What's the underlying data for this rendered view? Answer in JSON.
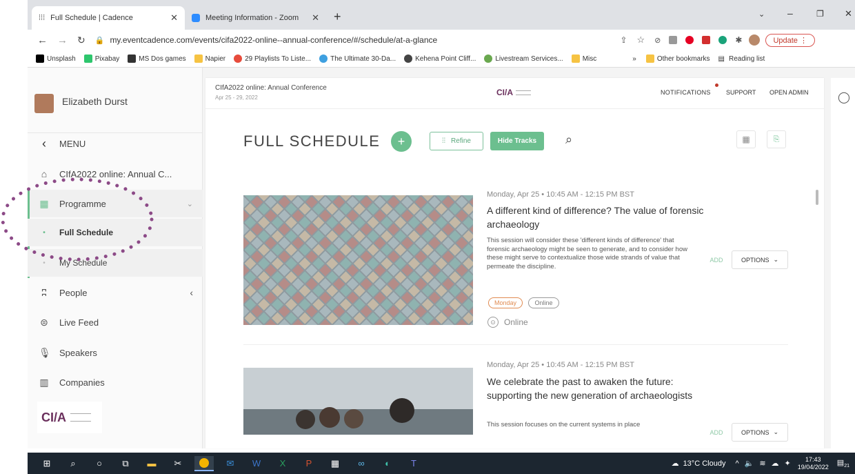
{
  "browser": {
    "tabs": [
      {
        "title": "Full Schedule | Cadence"
      },
      {
        "title": "Meeting Information - Zoom"
      }
    ],
    "url": "my.eventcadence.com/events/cifa2022-online--annual-conference/#/schedule/at-a-glance",
    "update_label": "Update",
    "bookmarks": [
      {
        "label": "Unsplash"
      },
      {
        "label": "Pixabay"
      },
      {
        "label": "MS Dos games"
      },
      {
        "label": "Napier"
      },
      {
        "label": "29 Playlists To Liste..."
      },
      {
        "label": "The Ultimate 30-Da..."
      },
      {
        "label": "Kehena Point Cliff..."
      },
      {
        "label": "Livestream Services..."
      },
      {
        "label": "Misc"
      }
    ],
    "overflow_label": "»",
    "other_bookmarks": "Other bookmarks",
    "reading_list": "Reading list"
  },
  "sidebar": {
    "user_name": "Elizabeth Durst",
    "menu_label": "MENU",
    "items": [
      {
        "label": "CIfA2022 online: Annual C..."
      },
      {
        "label": "Programme"
      },
      {
        "label": "Full Schedule"
      },
      {
        "label": "My Schedule"
      },
      {
        "label": "People"
      },
      {
        "label": "Live Feed"
      },
      {
        "label": "Speakers"
      },
      {
        "label": "Companies"
      }
    ],
    "logo_text": "CI/A"
  },
  "header": {
    "event_title": "CIfA2022 online: Annual Conference",
    "event_dates": "Apr 25 - 29, 2022",
    "logo_text": "CI/A",
    "nav": [
      "NOTIFICATIONS",
      "SUPPORT",
      "OPEN ADMIN"
    ]
  },
  "schedule": {
    "title": "FULL SCHEDULE",
    "refine_label": "Refine",
    "hide_tracks_label": "Hide Tracks",
    "sessions": [
      {
        "time": "Monday, Apr 25 • 10:45 AM - 12:15 PM BST",
        "title": "A different kind of difference? The value of forensic archaeology",
        "description": "This session will consider these 'different kinds of difference' that forensic archaeology might be seen to generate, and to consider how these might serve to contextualize those wide strands of value that permeate the discipline.",
        "tags": [
          "Monday",
          "Online"
        ],
        "location": "Online",
        "add_label": "ADD",
        "options_label": "OPTIONS"
      },
      {
        "time": "Monday, Apr 25 • 10:45 AM - 12:15 PM BST",
        "title": "We celebrate the past to awaken the future: supporting the new generation of archaeologists",
        "description": "This session focuses on the current systems in place",
        "add_label": "ADD",
        "options_label": "OPTIONS"
      }
    ]
  },
  "taskbar": {
    "weather": "13°C Cloudy",
    "time": "17:43",
    "date": "19/04/2022",
    "notif_count": "21"
  },
  "colors": {
    "accent": "#6cbf8f",
    "highlight_dots": "#8c4a87",
    "tag_orange": "#e08a50"
  }
}
